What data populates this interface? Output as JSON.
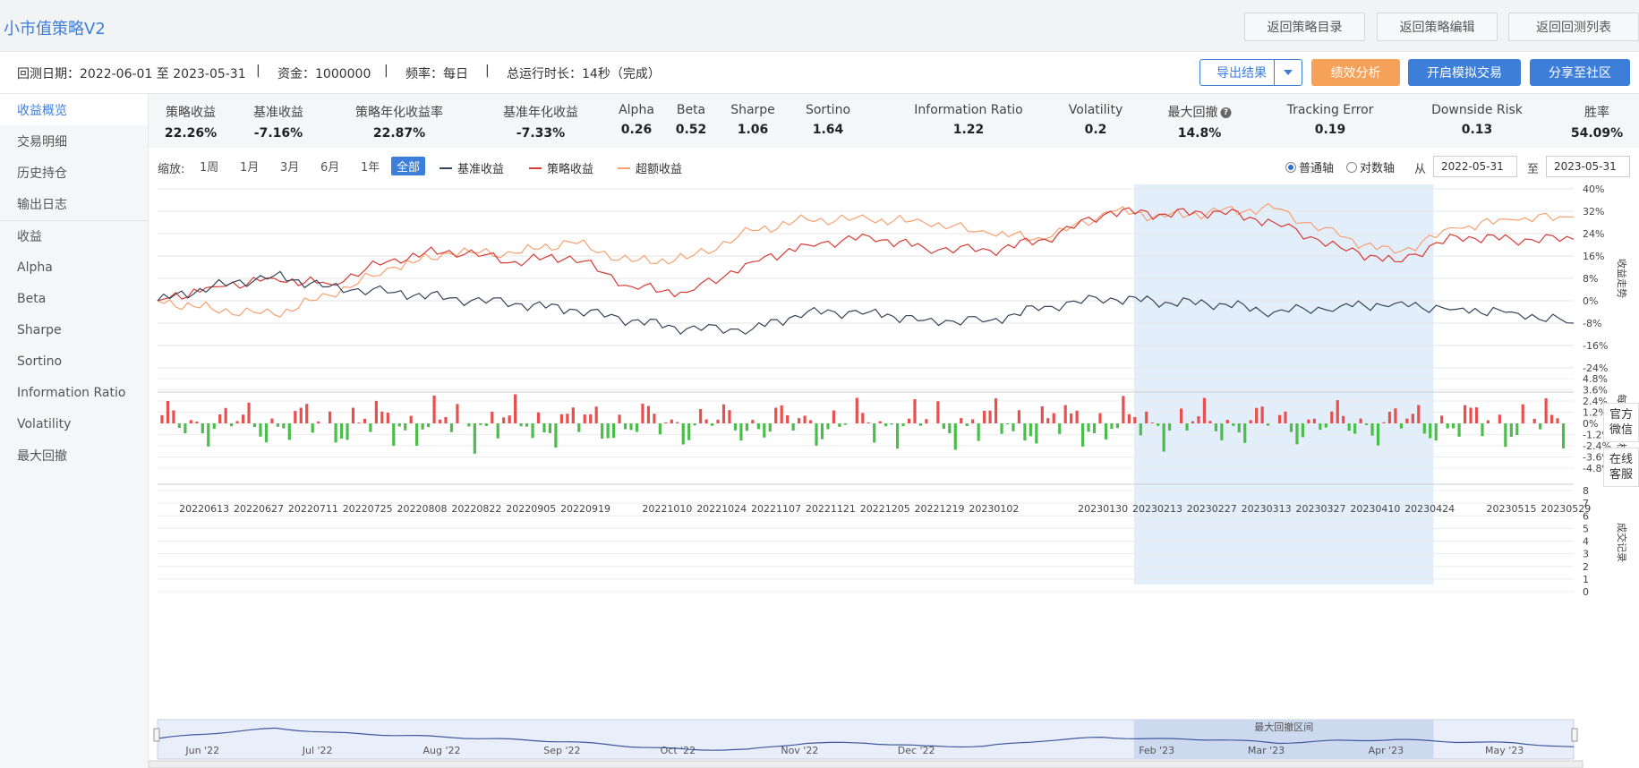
{
  "app": {
    "title": "小市值策略V2"
  },
  "nav": {
    "back_catalog": "返回策略目录",
    "back_edit": "返回策略编辑",
    "back_list": "返回回测列表"
  },
  "info": {
    "period": "回测日期：2022-06-01 至 2023-05-31",
    "capital": "资金：1000000",
    "frequency": "频率：每日",
    "runtime": "总运行时长：14秒（完成）",
    "separator": "|"
  },
  "actions": {
    "export": "导出结果",
    "analysis": "绩效分析",
    "sim_trade": "开启模拟交易",
    "share": "分享至社区"
  },
  "colors": {
    "accent": "#3d7ed9",
    "orange": "#f5a15a",
    "benchmark": "#34445a",
    "strategy": "#d83a34",
    "excess": "#f7a070",
    "up": "#e84f4f",
    "down": "#4bbd4b",
    "drawdown_band": "#e3eefb"
  },
  "sidebar": {
    "items": [
      {
        "label": "收益概览",
        "active": true
      },
      {
        "label": "交易明细"
      },
      {
        "label": "历史持仓"
      },
      {
        "label": "输出日志"
      },
      {
        "label": "收益"
      },
      {
        "label": "Alpha"
      },
      {
        "label": "Beta"
      },
      {
        "label": "Sharpe"
      },
      {
        "label": "Sortino"
      },
      {
        "label": "Information Ratio"
      },
      {
        "label": "Volatility"
      },
      {
        "label": "最大回撤"
      }
    ]
  },
  "metrics": [
    {
      "label": "策略收益",
      "value": "22.26%"
    },
    {
      "label": "基准收益",
      "value": "-7.16%"
    },
    {
      "label": "策略年化收益率",
      "value": "22.87%"
    },
    {
      "label": "基准年化收益",
      "value": "-7.33%"
    },
    {
      "label": "Alpha",
      "value": "0.26"
    },
    {
      "label": "Beta",
      "value": "0.52"
    },
    {
      "label": "Sharpe",
      "value": "1.06"
    },
    {
      "label": "Sortino",
      "value": "1.64"
    },
    {
      "label": "Information Ratio",
      "value": "1.22"
    },
    {
      "label": "Volatility",
      "value": "0.2"
    },
    {
      "label": "最大回撤",
      "value": "14.8%",
      "help": "?"
    },
    {
      "label": "Tracking Error",
      "value": "0.19"
    },
    {
      "label": "Downside Risk",
      "value": "0.13"
    },
    {
      "label": "胜率",
      "value": "54.09%"
    }
  ],
  "controls": {
    "zoom_label": "缩放:",
    "zoom_options": [
      "1周",
      "1月",
      "3月",
      "6月",
      "1年",
      "全部"
    ],
    "zoom_active": "全部",
    "axis_normal": "普通轴",
    "axis_log": "对数轴",
    "axis_selected": "普通轴",
    "from_label": "从",
    "to_label": "至",
    "from_date": "2022-05-31",
    "to_date": "2023-05-31"
  },
  "float_panel": {
    "wechat": "官方微信",
    "service": "在线客服"
  },
  "chart_data": [
    {
      "type": "line",
      "panel": "returns",
      "axis_title": "收益走势",
      "band_label": "最大回撤区间",
      "drawdown_start": "20230207",
      "drawdown_end": "20230425",
      "y_ticks": [
        "40%",
        "32%",
        "24%",
        "16%",
        "8%",
        "0%",
        "-8%",
        "-16%",
        "-24%"
      ],
      "ylim": [
        -24,
        40
      ],
      "legend_position": "top-left",
      "x_ticks": [
        "20220613",
        "20220627",
        "20220711",
        "20220725",
        "20220808",
        "20220822",
        "20220905",
        "20220919",
        "20221010",
        "20221024",
        "20221107",
        "20221121",
        "20221205",
        "20221219",
        "20230102",
        "20230130",
        "20230213",
        "20230227",
        "20230313",
        "20230327",
        "20230410",
        "20230424",
        "20230515",
        "20230529"
      ],
      "x": [
        "20220601",
        "20220615",
        "20220701",
        "20220715",
        "20220801",
        "20220815",
        "20220901",
        "20220915",
        "20221001",
        "20221015",
        "20221101",
        "20221115",
        "20221201",
        "20221215",
        "20230101",
        "20230115",
        "20230201",
        "20230215",
        "20230301",
        "20230315",
        "20230401",
        "20230415",
        "20230501",
        "20230515",
        "20230531"
      ],
      "series": [
        {
          "name": "基准收益",
          "values": [
            0,
            5,
            9,
            5,
            3,
            1,
            -1,
            -3,
            -7,
            -10,
            -10,
            -4,
            -4,
            -7,
            -7,
            -2,
            1,
            -0.5,
            -1,
            -4,
            -2,
            -1,
            -3,
            -4,
            -8
          ]
        },
        {
          "name": "策略收益",
          "values": [
            0,
            5,
            8,
            6,
            15,
            18,
            14,
            16,
            5,
            3,
            14,
            20,
            23,
            19,
            18,
            22,
            32,
            31,
            32,
            28,
            19,
            14,
            23,
            22,
            22
          ]
        },
        {
          "name": "超额收益",
          "values": [
            0,
            -3,
            -5,
            2,
            12,
            17,
            17,
            21,
            14,
            15,
            25,
            29,
            29,
            28,
            24,
            22,
            32,
            30,
            32,
            33,
            23,
            17,
            26,
            29,
            30
          ]
        }
      ]
    },
    {
      "type": "bar",
      "panel": "daily_pnl",
      "axis_title": "每日盈亏分析",
      "y_ticks": [
        "4.8%",
        "3.6%",
        "2.4%",
        "1.2%",
        "0%",
        "-1.2%",
        "-2.4%",
        "-3.6%",
        "-4.8%"
      ],
      "ylim": [
        -4.8,
        4.8
      ]
    },
    {
      "type": "bar",
      "panel": "trades",
      "axis_title": "成交记录",
      "y_ticks": [
        "8",
        "7",
        "6",
        "5",
        "4",
        "3",
        "2",
        "1",
        "0"
      ],
      "ylim": [
        0,
        8
      ]
    },
    {
      "type": "area",
      "panel": "navigator",
      "band_label": "最大回撤区间",
      "month_labels": [
        "Jun '22",
        "Jul '22",
        "Aug '22",
        "Sep '22",
        "Oct '22",
        "Nov '22",
        "Dec '22",
        "Feb '23",
        "Mar '23",
        "Apr '23",
        "May '23"
      ]
    }
  ]
}
